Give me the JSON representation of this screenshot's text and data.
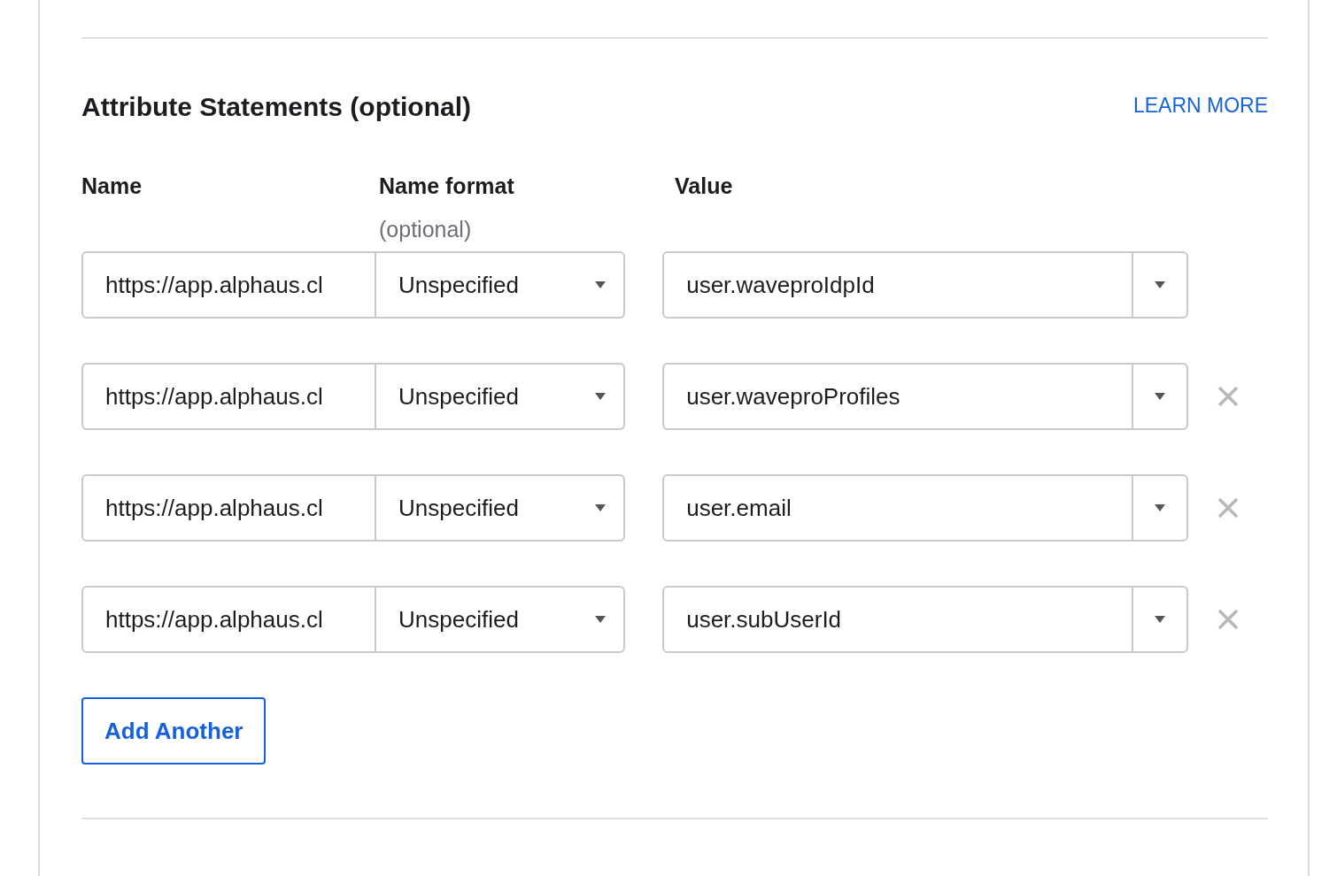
{
  "section": {
    "title": "Attribute Statements (optional)",
    "learn_more": "LEARN MORE"
  },
  "columns": [
    {
      "label": "Name"
    },
    {
      "label": "Name format",
      "hint": "(optional)"
    },
    {
      "label": "Value"
    }
  ],
  "rows": [
    {
      "name": "https://app.alphaus.cl",
      "format": "Unspecified",
      "value": "user.waveproIdpId",
      "removable": false
    },
    {
      "name": "https://app.alphaus.cl",
      "format": "Unspecified",
      "value": "user.waveproProfiles",
      "removable": true
    },
    {
      "name": "https://app.alphaus.cl",
      "format": "Unspecified",
      "value": "user.email",
      "removable": true
    },
    {
      "name": "https://app.alphaus.cl",
      "format": "Unspecified",
      "value": "user.subUserId",
      "removable": true
    }
  ],
  "add_button": "Add Another"
}
